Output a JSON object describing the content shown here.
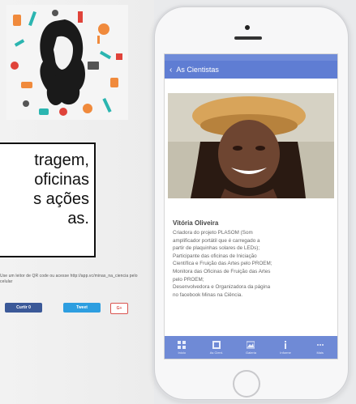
{
  "callout": {
    "lines": [
      "tragem,",
      "oficinas",
      "s ações",
      "as."
    ]
  },
  "qr_note": "Use um leitor de QR code ou acesse http://app.vc/minas_na_ciencia pelo celular",
  "social": {
    "facebook_label": "Curtir 0",
    "twitter_label": "Tweet",
    "gplus_label": "G+"
  },
  "app": {
    "nav_title": "As Cientistas",
    "person_name": "Vitória Oliveira",
    "bio_lines": [
      "Criadora do projeto PLASOM (Som",
      "amplificador portátil que é carregado a",
      "partir de plaquinhas solares de LEDs);",
      "Participante das oficinas de Iniciação",
      "Científica e Fruição das Artes pelo PROEM;",
      "Monitora das Oficinas de Fruição das Artes",
      "pelo PROEM;",
      "Desenvolvedora e Organizadora da página",
      "no facebook Minas na Ciência."
    ],
    "tabs": [
      {
        "label": "Início",
        "icon": "grid-icon"
      },
      {
        "label": "As Cient.",
        "icon": "grid-icon"
      },
      {
        "label": "Galeria",
        "icon": "image-icon"
      },
      {
        "label": "Informe",
        "icon": "info-icon"
      },
      {
        "label": "Mais",
        "icon": "more-icon"
      }
    ]
  },
  "colors": {
    "nav_blue": "#5f7dd3",
    "tab_blue": "#6f8ad6",
    "accent_orange": "#f08a3c",
    "accent_teal": "#2bb5b0"
  }
}
